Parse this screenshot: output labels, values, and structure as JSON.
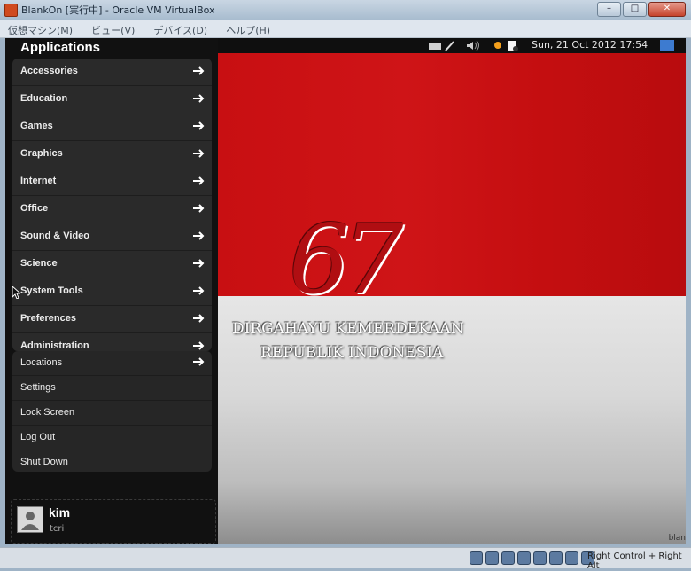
{
  "window": {
    "title": "BlankOn [実行中] - Oracle VM VirtualBox"
  },
  "menubar": [
    "仮想マシン(M)",
    "ビュー(V)",
    "デバイス(D)",
    "ヘルプ(H)"
  ],
  "panel": {
    "clock": "Sun, 21 Oct 2012 17:54"
  },
  "sidebar": {
    "title": "Applications",
    "categories": [
      "Accessories",
      "Education",
      "Games",
      "Graphics",
      "Internet",
      "Office",
      "Sound & Video",
      "Science",
      "System Tools",
      "Preferences",
      "Administration"
    ],
    "system_items": [
      "Locations",
      "Settings",
      "Lock Screen",
      "Log Out",
      "Shut Down"
    ],
    "user": {
      "name": "kim",
      "status": "tcri"
    }
  },
  "wallpaper": {
    "number": "67",
    "line1": "DIRGAHAYU KEMERDEKAAN",
    "line2": "REPUBLIK INDONESIA",
    "corner_text": "blan"
  },
  "statusbar": {
    "host_key": "Right Control + Right Alt"
  },
  "colors": {
    "flag_red": "#c80f12",
    "flag_white": "#e6e6e6",
    "panel_bg": "#0f0f0f"
  }
}
